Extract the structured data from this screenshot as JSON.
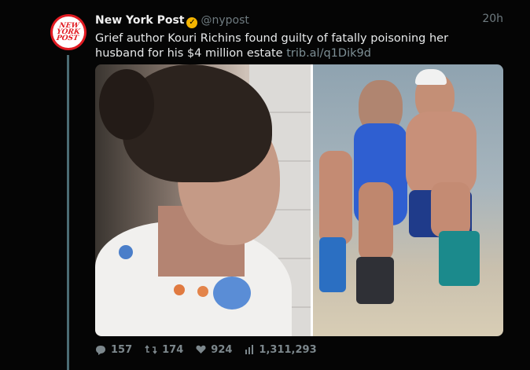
{
  "tweet": {
    "display_name": "New York Post",
    "verified_badge": "verified-icon",
    "handle": "@nypost",
    "time": "20h",
    "text": "Grief author Kouri Richins found guilty of fatally poisoning her husband for his $4 million estate",
    "link": "trib.al/q1Dik9d",
    "avatar_text": [
      "NEW",
      "YORK",
      "POST"
    ]
  },
  "actions": {
    "replies": "157",
    "retweets": "174",
    "likes": "924",
    "views": "1,311,293"
  },
  "colors": {
    "background": "#050505",
    "thread_line": "#4b6b73",
    "brand_red": "#e11b22",
    "verified_gold": "#f4b400"
  }
}
